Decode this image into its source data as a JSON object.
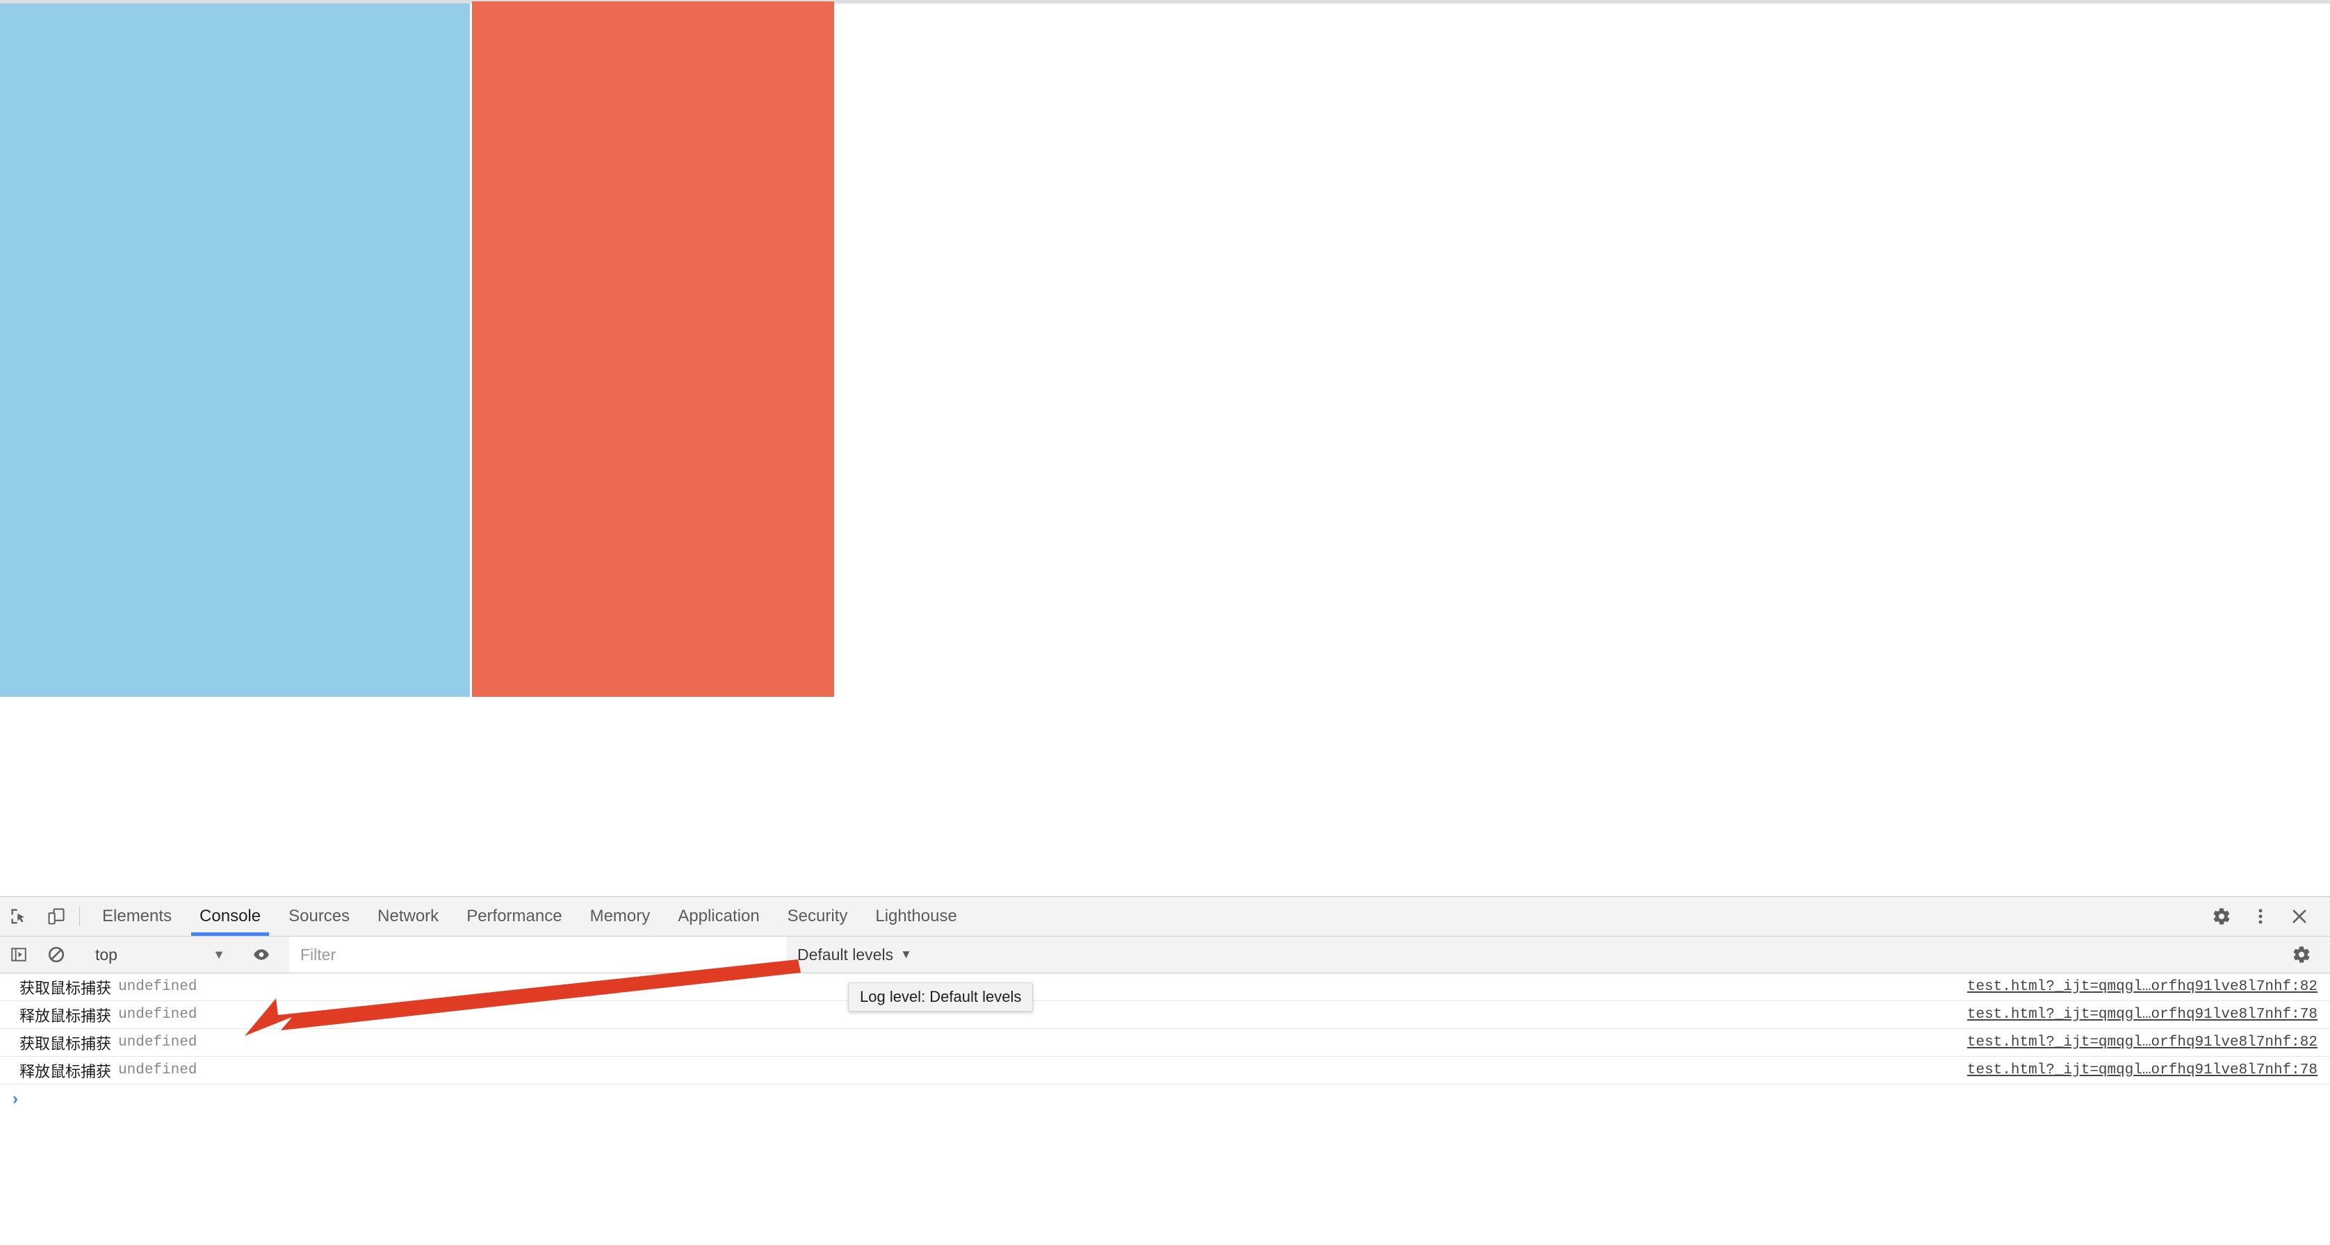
{
  "page": {
    "blocks": [
      {
        "name": "blue-block",
        "color": "#93cde9"
      },
      {
        "name": "red-block",
        "color": "#ec6a51"
      }
    ],
    "top_strip_color": "#dcdee1"
  },
  "devtools": {
    "accent_color": "#4285f4",
    "toolbar_bg": "#f3f3f3",
    "tab_bar": {
      "inspect_icon": "inspect-element-icon",
      "device_icon": "device-toolbar-icon",
      "tabs": [
        {
          "label": "Elements",
          "active": false
        },
        {
          "label": "Console",
          "active": true
        },
        {
          "label": "Sources",
          "active": false
        },
        {
          "label": "Network",
          "active": false
        },
        {
          "label": "Performance",
          "active": false
        },
        {
          "label": "Memory",
          "active": false
        },
        {
          "label": "Application",
          "active": false
        },
        {
          "label": "Security",
          "active": false
        },
        {
          "label": "Lighthouse",
          "active": false
        }
      ],
      "right_icons": [
        {
          "name": "settings-gear-icon"
        },
        {
          "name": "more-options-kebab-icon"
        },
        {
          "name": "close-devtools-icon"
        }
      ]
    },
    "filter_bar": {
      "sidebar_toggle_icon": "console-sidebar-toggle-icon",
      "clear_console_icon": "clear-console-icon",
      "context_value": "top",
      "context_caret": "▼",
      "eye_icon": "live-expression-eye-icon",
      "filter_value": "",
      "filter_placeholder": "Filter",
      "log_level_label": "Default levels",
      "log_level_caret": "▼",
      "settings_icon": "console-settings-gear-icon"
    },
    "tooltip": {
      "text": "Log level: Default levels"
    },
    "messages": [
      {
        "text": "获取鼠标捕获",
        "value": "undefined",
        "source": "test.html?_ijt=qmqgl…orfhq91lve8l7nhf:82"
      },
      {
        "text": "释放鼠标捕获",
        "value": "undefined",
        "source": "test.html?_ijt=qmqgl…orfhq91lve8l7nhf:78"
      },
      {
        "text": "获取鼠标捕获",
        "value": "undefined",
        "source": "test.html?_ijt=qmqgl…orfhq91lve8l7nhf:82"
      },
      {
        "text": "释放鼠标捕获",
        "value": "undefined",
        "source": "test.html?_ijt=qmqgl…orfhq91lve8l7nhf:78"
      }
    ],
    "prompt": {
      "chevron": "›"
    }
  },
  "annotation": {
    "arrow_color": "#e03c24",
    "arrow_name": "red-annotation-arrow"
  }
}
